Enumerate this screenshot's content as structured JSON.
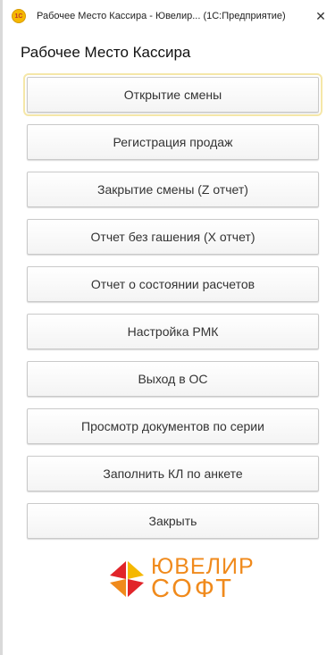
{
  "window": {
    "title": "Рабочее Место Кассира - Ювелир... (1С:Предприятие)",
    "app_icon_label": "1С",
    "close_glyph": "✕"
  },
  "heading": "Рабочее Место Кассира",
  "buttons": [
    {
      "label": "Открытие смены"
    },
    {
      "label": "Регистрация продаж"
    },
    {
      "label": "Закрытие смены (Z отчет)"
    },
    {
      "label": "Отчет без гашения (X отчет)"
    },
    {
      "label": "Отчет о состоянии расчетов"
    },
    {
      "label": "Настройка РМК"
    },
    {
      "label": "Выход в ОС"
    },
    {
      "label": "Просмотр документов по серии"
    },
    {
      "label": "Заполнить КЛ по анкете"
    },
    {
      "label": "Закрыть"
    }
  ],
  "logo": {
    "line1": "ЮВЕЛИР",
    "line2": "СОФТ",
    "colors": {
      "red": "#e1252a",
      "orange": "#f08a1c",
      "yellow": "#f5b800"
    }
  }
}
